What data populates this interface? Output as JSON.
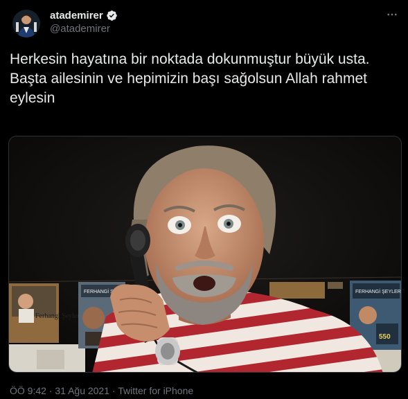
{
  "author": {
    "display_name": "atademirer",
    "handle": "@atademirer",
    "verified": true
  },
  "tweet": {
    "lines": [
      "Herkesin hayatına bir noktada dokunmuştur büyük usta.",
      "Başta ailesinin ve hepimizin başı sağolsun Allah rahmet eylesin"
    ]
  },
  "media": {
    "posters": [
      {
        "title": "Ferhangi Şeyler"
      },
      {
        "title": "FERHANGİ ŞEYLER"
      },
      {
        "title": "FERHANGİ ŞEYLER"
      },
      {
        "title": "550"
      }
    ]
  },
  "meta": {
    "time": "ÖÖ 9:42",
    "separator": " · ",
    "date": "31 Ağu 2021",
    "source": "Twitter for iPhone"
  },
  "icons": {
    "verified": "verified-badge-icon",
    "more": "more-options-icon"
  },
  "colors": {
    "background": "#000000",
    "text": "#e7e9ea",
    "secondary": "#71767b",
    "verified_fill": "#e7e9ea"
  }
}
